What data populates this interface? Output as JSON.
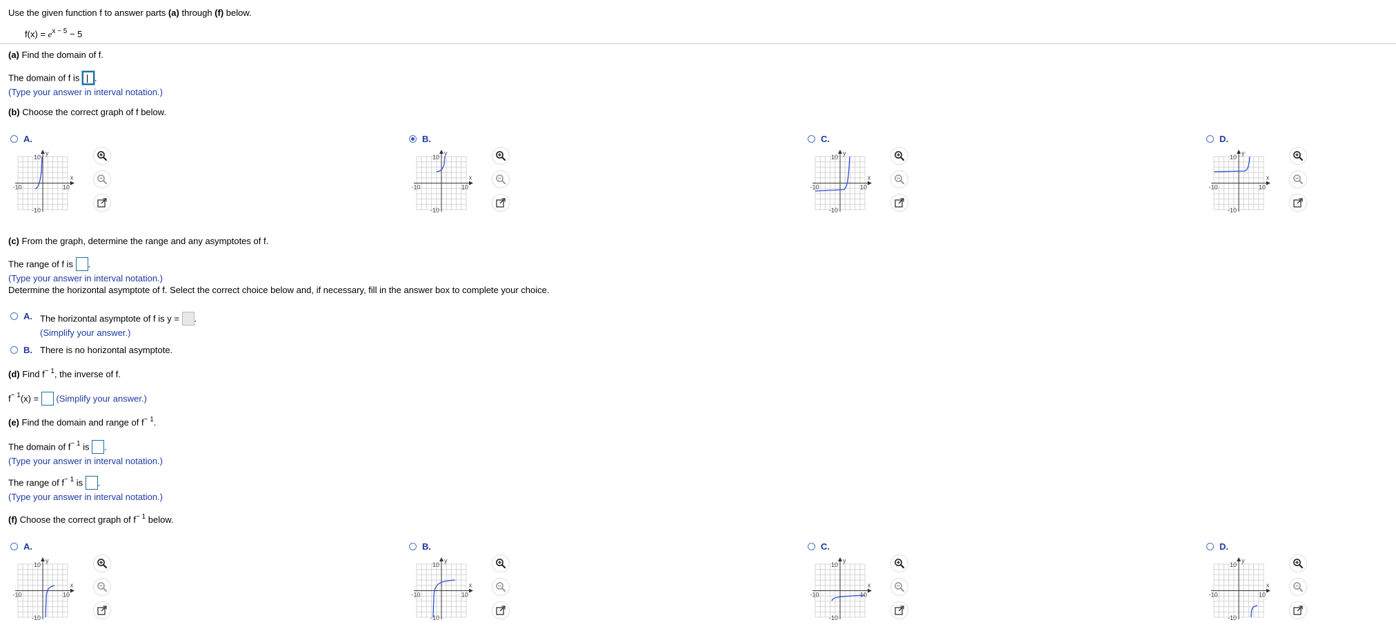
{
  "intro": {
    "text": "Use the given function f to answer parts ",
    "part_a": "(a)",
    "mid": " through ",
    "part_f": "(f)",
    "end": " below."
  },
  "function": {
    "lhs": "f(x) = ",
    "base": "e",
    "exponent": "x − 5",
    "tail": " − 5"
  },
  "part_a": {
    "label": "(a)",
    "question": " Find the domain of f.",
    "answer_prefix": "The domain of f is ",
    "hint": "(Type your answer in interval notation.)"
  },
  "part_b": {
    "label": "(b)",
    "question": " Choose the correct graph of f below.",
    "options": [
      {
        "letter": "A."
      },
      {
        "letter": "B.",
        "selected": true
      },
      {
        "letter": "C."
      },
      {
        "letter": "D."
      }
    ]
  },
  "part_c": {
    "label": "(c)",
    "question": " From the graph, determine the range and any asymptotes of f.",
    "range_prefix": "The range of f is ",
    "hint": "(Type your answer in interval notation.)",
    "asymptote_prompt": "Determine the horizontal asymptote of f. Select the correct choice below and, if necessary, fill in the answer box to complete your choice.",
    "choice_a_letter": "A.",
    "choice_a_text": "The horizontal asymptote of f is y = ",
    "choice_a_hint": "(Simplify your answer.)",
    "choice_b_letter": "B.",
    "choice_b_text": "There is no horizontal asymptote."
  },
  "part_d": {
    "label": "(d)",
    "q_pre": " Find f",
    "q_sup": "− 1",
    "q_post": ", the inverse of f.",
    "ans_f": "f",
    "ans_sup": "− 1",
    "ans_x": "(x) = ",
    "hint": "(Simplify your answer.)"
  },
  "part_e": {
    "label": "(e)",
    "q_pre": " Find the domain and range of f",
    "q_sup": "− 1",
    "q_post": ".",
    "domain_pre": "The domain of f",
    "domain_sup": "− 1",
    "domain_post": " is ",
    "hint1": "(Type your answer in interval notation.)",
    "range_pre": "The range of f",
    "range_sup": "− 1",
    "range_post": " is ",
    "hint2": "(Type your answer in interval notation.)"
  },
  "part_f": {
    "label": "(f)",
    "q_pre": " Choose the correct graph of f",
    "q_sup": "− 1",
    "q_post": " below.",
    "options": [
      {
        "letter": "A."
      },
      {
        "letter": "B."
      },
      {
        "letter": "C."
      },
      {
        "letter": "D."
      }
    ]
  },
  "graph_labels": {
    "tick_pos": "10",
    "tick_neg": "-10",
    "x_axis": "x",
    "y_axis": "y"
  },
  "icons": [
    "zoom-in-icon",
    "zoom-out-icon",
    "open-external-icon"
  ],
  "colors": {
    "accent": "#1d3aa3",
    "curve": "#2a4fd8",
    "answer_border": "#1a6f9e",
    "grid": "#d4d4d4"
  }
}
